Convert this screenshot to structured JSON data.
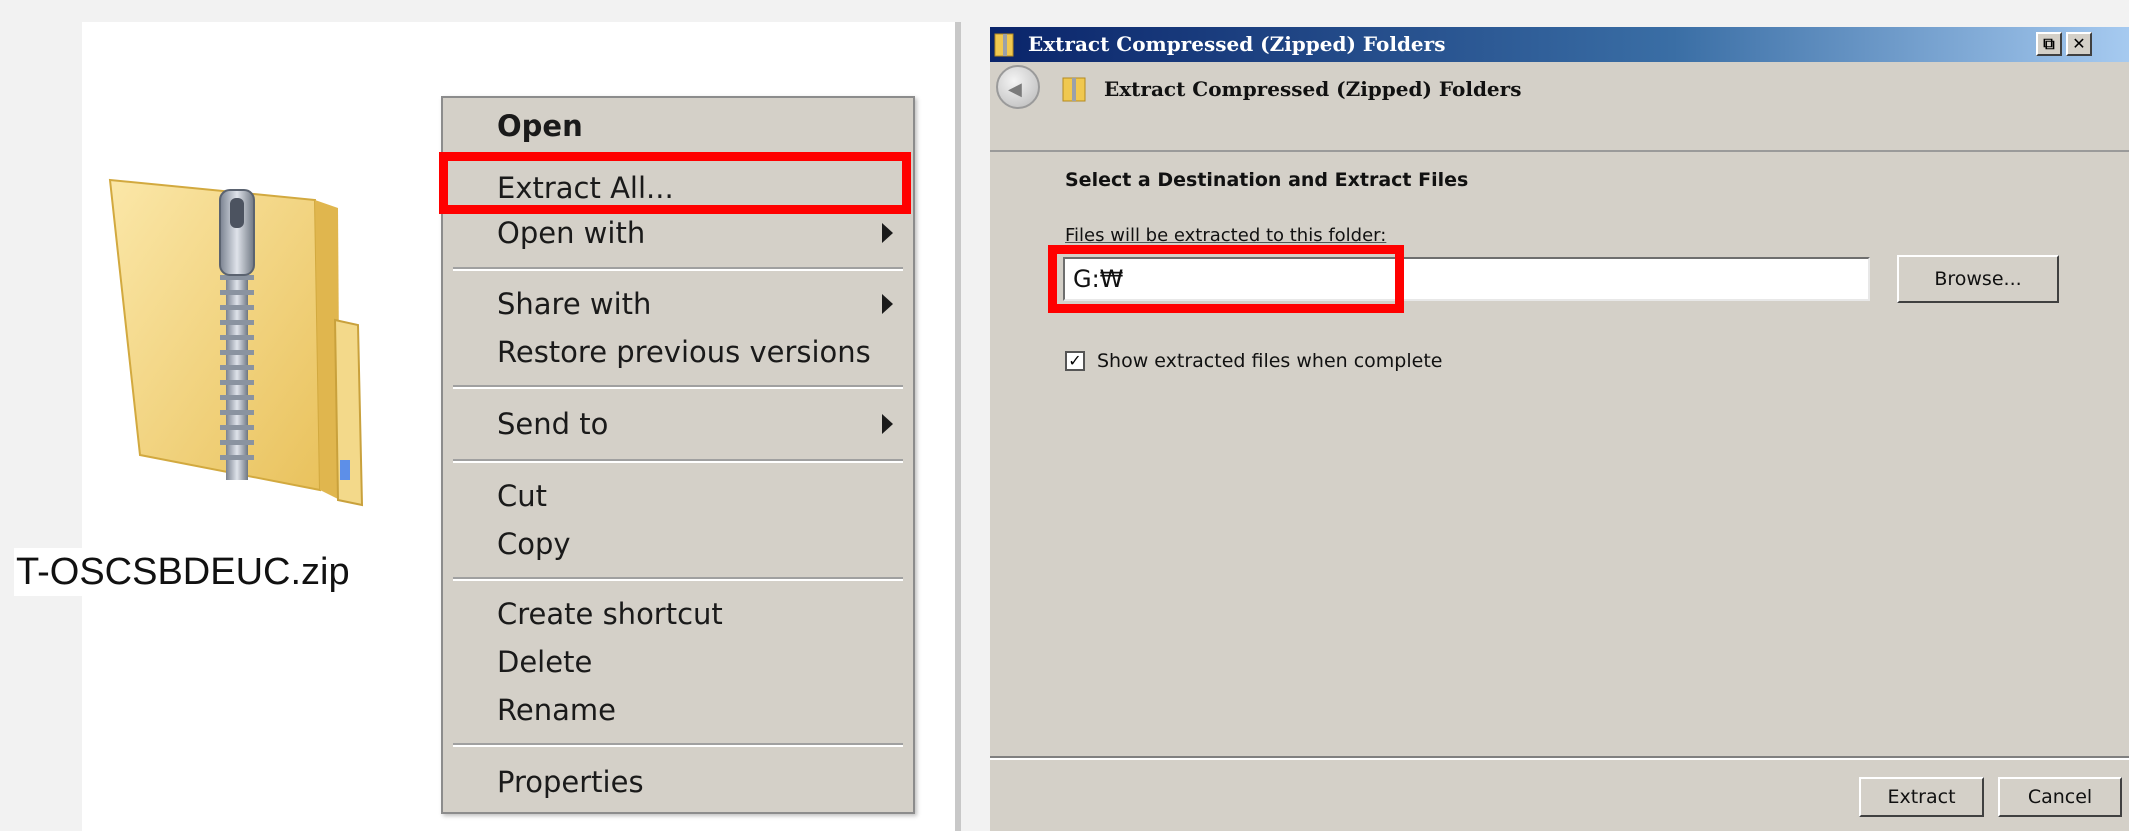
{
  "file": {
    "name": "T-OSCSBDEUC.zip",
    "icon": "zipped-folder-icon"
  },
  "context_menu": {
    "items": [
      {
        "label": "Open",
        "bold": true
      },
      {
        "label": "Extract All...",
        "highlighted": true
      },
      {
        "label": "Open with",
        "submenu": true
      },
      {
        "label": "Share with",
        "submenu": true
      },
      {
        "label": "Restore previous versions"
      },
      {
        "label": "Send to",
        "submenu": true
      },
      {
        "label": "Cut"
      },
      {
        "label": "Copy"
      },
      {
        "label": "Create shortcut"
      },
      {
        "label": "Delete"
      },
      {
        "label": "Rename"
      },
      {
        "label": "Properties"
      }
    ]
  },
  "dialog": {
    "window_title": "Extract Compressed (Zipped) Folders",
    "header_title": "Extract Compressed (Zipped) Folders",
    "section_heading": "Select a Destination and Extract Files",
    "path_label": "Files will be extracted to this folder:",
    "path_value": "G:₩",
    "browse_label": "Browse...",
    "show_files_label": "Show extracted files when complete",
    "show_files_checked": true,
    "extract_label": "Extract",
    "cancel_label": "Cancel",
    "restore_glyph": "⧉",
    "close_glyph": "✕"
  },
  "colors": {
    "highlight": "#ff0000",
    "titlebar_start": "#0a246a",
    "dialog_bg": "#d4d0c8"
  }
}
